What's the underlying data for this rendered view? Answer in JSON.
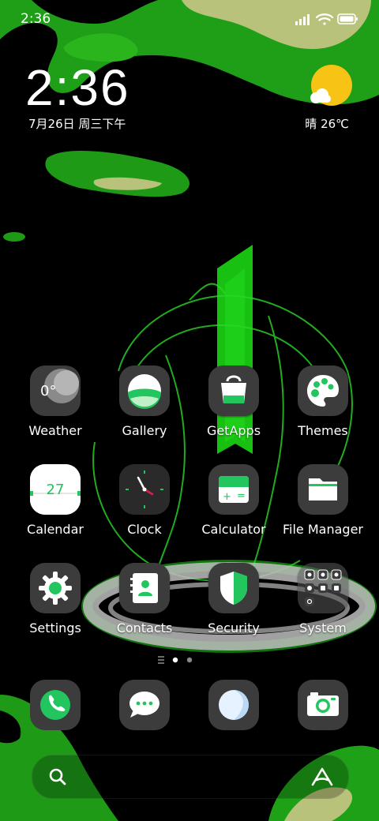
{
  "status_bar": {
    "time": "2:36"
  },
  "clock_widget": {
    "time": "2:36",
    "date": "7月26日 周三下午"
  },
  "weather_widget": {
    "condition_icon": "sun-cloud-icon",
    "summary": "晴 26℃"
  },
  "home_apps": [
    {
      "label": "Weather",
      "icon": "weather-icon",
      "badge_text": "0°"
    },
    {
      "label": "Gallery",
      "icon": "gallery-icon"
    },
    {
      "label": "GetApps",
      "icon": "getapps-bag-icon"
    },
    {
      "label": "Themes",
      "icon": "palette-icon"
    },
    {
      "label": "Calendar",
      "icon": "calendar-icon",
      "badge_text": "27"
    },
    {
      "label": "Clock",
      "icon": "clock-icon"
    },
    {
      "label": "Calculator",
      "icon": "calculator-icon"
    },
    {
      "label": "File Manager",
      "icon": "folder-icon"
    },
    {
      "label": "Settings",
      "icon": "gear-icon"
    },
    {
      "label": "Contacts",
      "icon": "contacts-book-icon"
    },
    {
      "label": "Security",
      "icon": "shield-icon"
    },
    {
      "label": "System",
      "icon": "app-folder-icon"
    }
  ],
  "pager": {
    "pages": 2,
    "current": 1
  },
  "dock": [
    {
      "icon": "phone-icon"
    },
    {
      "icon": "messages-icon"
    },
    {
      "icon": "browser-icon"
    },
    {
      "icon": "camera-icon"
    }
  ],
  "search_bar": {
    "search_icon": "search-icon",
    "assistant_icon": "assistant-a-icon"
  },
  "colors": {
    "accent_green": "#22c55e",
    "icon_bg": "#3c3c3c",
    "sun_yellow": "#f7c415"
  }
}
